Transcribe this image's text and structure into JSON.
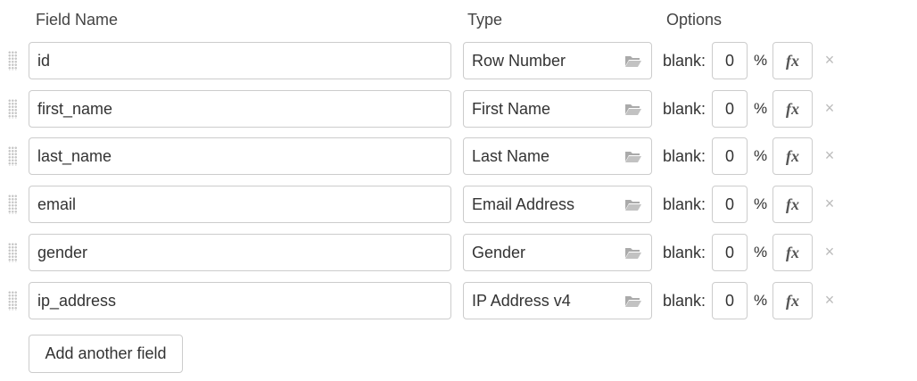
{
  "headers": {
    "field_name": "Field Name",
    "type": "Type",
    "options": "Options"
  },
  "fields": [
    {
      "name": "id",
      "type": "Row Number",
      "blank_label": "blank:",
      "blank_value": "0",
      "percent": "%",
      "fx_label": "fx",
      "remove_glyph": "×"
    },
    {
      "name": "first_name",
      "type": "First Name",
      "blank_label": "blank:",
      "blank_value": "0",
      "percent": "%",
      "fx_label": "fx",
      "remove_glyph": "×"
    },
    {
      "name": "last_name",
      "type": "Last Name",
      "blank_label": "blank:",
      "blank_value": "0",
      "percent": "%",
      "fx_label": "fx",
      "remove_glyph": "×"
    },
    {
      "name": "email",
      "type": "Email Address",
      "blank_label": "blank:",
      "blank_value": "0",
      "percent": "%",
      "fx_label": "fx",
      "remove_glyph": "×"
    },
    {
      "name": "gender",
      "type": "Gender",
      "blank_label": "blank:",
      "blank_value": "0",
      "percent": "%",
      "fx_label": "fx",
      "remove_glyph": "×"
    },
    {
      "name": "ip_address",
      "type": "IP Address v4",
      "blank_label": "blank:",
      "blank_value": "0",
      "percent": "%",
      "fx_label": "fx",
      "remove_glyph": "×"
    }
  ],
  "add_button_label": "Add another field",
  "icons": {
    "drag": "drag-handle-icon",
    "folder": "folder-open-icon",
    "remove": "close-icon"
  },
  "colors": {
    "border": "#cccccc",
    "text": "#333333",
    "muted": "#bbbbbb"
  }
}
